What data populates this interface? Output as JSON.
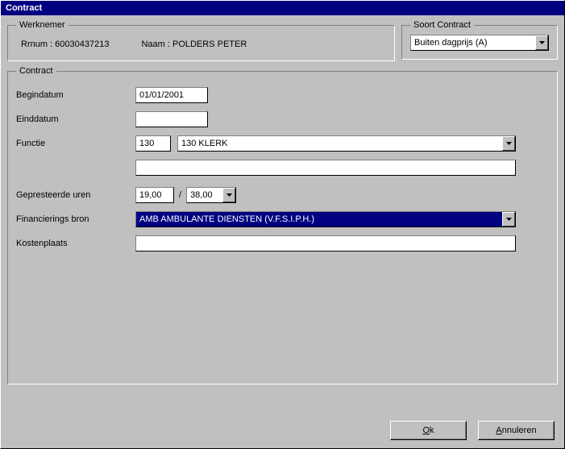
{
  "window": {
    "title": "Contract"
  },
  "werknemer": {
    "legend": "Werknemer",
    "rrnum_label": "Rrnum : 60030437213",
    "naam_label": "Naam : POLDERS PETER"
  },
  "soort": {
    "legend": "Soort Contract",
    "value": "Buiten dagprijs (A)"
  },
  "contract": {
    "legend": "Contract",
    "begindatum_label": "Begindatum",
    "begindatum_value": "01/01/2001",
    "einddatum_label": "Einddatum",
    "einddatum_value": "",
    "functie_label": "Functie",
    "functie_code": "130",
    "functie_text": "130 KLERK",
    "functie_extra": "",
    "uren_label": "Gepresteerde uren",
    "uren_value": "19,00",
    "uren_total": "38,00",
    "slash": "/",
    "financ_label": "Financierings bron",
    "financ_value": "AMB AMBULANTE DIENSTEN (V.F.S.I.P.H.)",
    "kosten_label": "Kostenplaats",
    "kosten_value": ""
  },
  "buttons": {
    "ok_pre": "",
    "ok_mn": "O",
    "ok_post": "k",
    "cancel_pre": "",
    "cancel_mn": "A",
    "cancel_post": "nnuleren"
  }
}
